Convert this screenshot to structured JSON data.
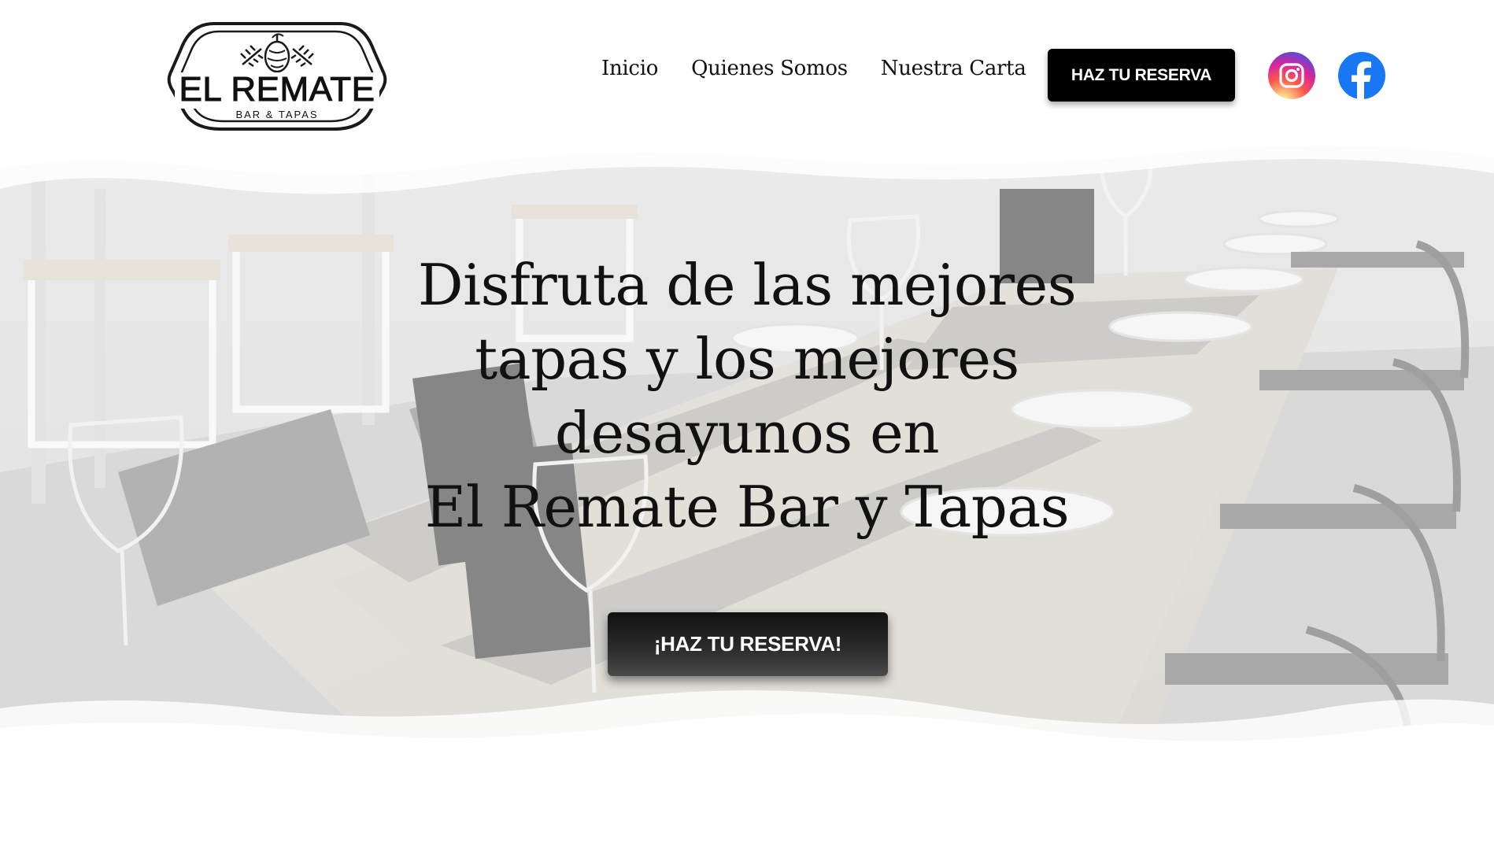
{
  "brand": {
    "name": "EL REMATE",
    "tagline": "BAR & TAPAS"
  },
  "nav": {
    "items": [
      {
        "label": "Inicio"
      },
      {
        "label": "Quienes Somos"
      },
      {
        "label": "Nuestra Carta"
      }
    ],
    "cta_label": "HAZ TU RESERVA"
  },
  "social": {
    "instagram_icon": "instagram-icon",
    "facebook_icon": "facebook-icon"
  },
  "hero": {
    "title_lines": [
      "Disfruta de las mejores",
      "tapas y los mejores",
      "desayunos en",
      "El Remate Bar y Tapas"
    ],
    "cta_label": "¡HAZ TU RESERVA!"
  },
  "colors": {
    "cta_background": "#000000",
    "cta_text": "#ffffff",
    "facebook": "#1877f2",
    "text": "#111111"
  }
}
